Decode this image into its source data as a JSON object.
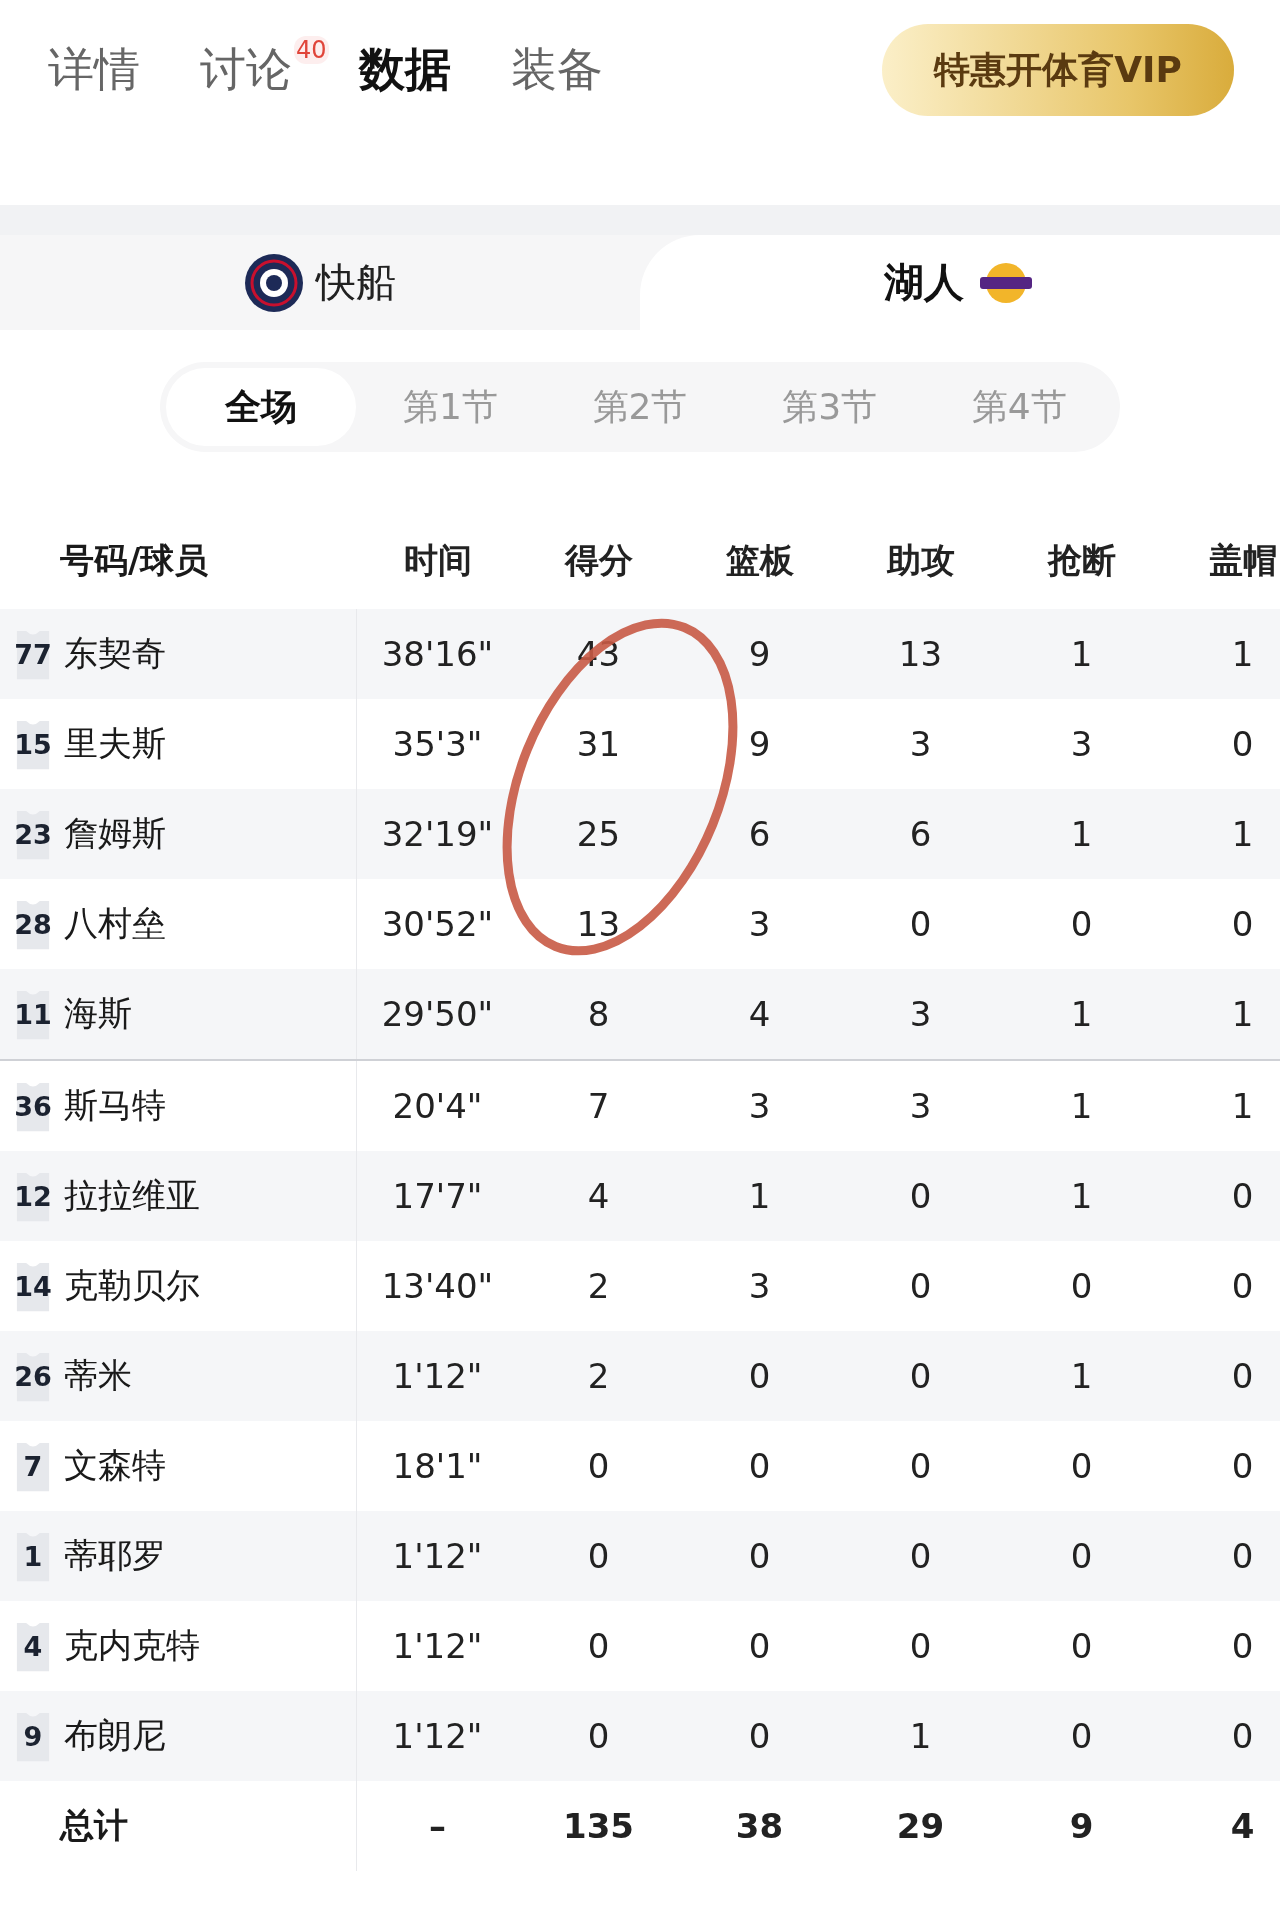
{
  "nav_tabs": [
    {
      "label": "详情",
      "selected": false
    },
    {
      "label": "讨论",
      "selected": false,
      "badge": "40"
    },
    {
      "label": "数据",
      "selected": true
    },
    {
      "label": "装备",
      "selected": false
    }
  ],
  "vip_button": "特惠开体育VIP",
  "teams": [
    {
      "name": "快船",
      "selected": false
    },
    {
      "name": "湖人",
      "selected": true
    }
  ],
  "periods": [
    {
      "label": "全场",
      "selected": true
    },
    {
      "label": "第1节",
      "selected": false
    },
    {
      "label": "第2节",
      "selected": false
    },
    {
      "label": "第3节",
      "selected": false
    },
    {
      "label": "第4节",
      "selected": false
    }
  ],
  "table": {
    "columns": [
      "号码/球员",
      "时间",
      "得分",
      "篮板",
      "助攻",
      "抢断",
      "盖帽"
    ],
    "starters": [
      {
        "number": "77",
        "name": "东契奇",
        "stats": [
          "38'16\"",
          "43",
          "9",
          "13",
          "1",
          "1"
        ]
      },
      {
        "number": "15",
        "name": "里夫斯",
        "stats": [
          "35'3\"",
          "31",
          "9",
          "3",
          "3",
          "0"
        ]
      },
      {
        "number": "23",
        "name": "詹姆斯",
        "stats": [
          "32'19\"",
          "25",
          "6",
          "6",
          "1",
          "1"
        ]
      },
      {
        "number": "28",
        "name": "八村垒",
        "stats": [
          "30'52\"",
          "13",
          "3",
          "0",
          "0",
          "0"
        ]
      },
      {
        "number": "11",
        "name": "海斯",
        "stats": [
          "29'50\"",
          "8",
          "4",
          "3",
          "1",
          "1"
        ]
      }
    ],
    "bench": [
      {
        "number": "36",
        "name": "斯马特",
        "stats": [
          "20'4\"",
          "7",
          "3",
          "3",
          "1",
          "1"
        ]
      },
      {
        "number": "12",
        "name": "拉拉维亚",
        "stats": [
          "17'7\"",
          "4",
          "1",
          "0",
          "1",
          "0"
        ]
      },
      {
        "number": "14",
        "name": "克勒贝尔",
        "stats": [
          "13'40\"",
          "2",
          "3",
          "0",
          "0",
          "0"
        ]
      },
      {
        "number": "26",
        "name": "蒂米",
        "stats": [
          "1'12\"",
          "2",
          "0",
          "0",
          "1",
          "0"
        ]
      },
      {
        "number": "7",
        "name": "文森特",
        "stats": [
          "18'1\"",
          "0",
          "0",
          "0",
          "0",
          "0"
        ]
      },
      {
        "number": "1",
        "name": "蒂耶罗",
        "stats": [
          "1'12\"",
          "0",
          "0",
          "0",
          "0",
          "0"
        ]
      },
      {
        "number": "4",
        "name": "克内克特",
        "stats": [
          "1'12\"",
          "0",
          "0",
          "0",
          "0",
          "0"
        ]
      },
      {
        "number": "9",
        "name": "布朗尼",
        "stats": [
          "1'12\"",
          "0",
          "0",
          "1",
          "0",
          "0"
        ]
      }
    ],
    "total": {
      "label": "总计",
      "stats": [
        "–",
        "135",
        "38",
        "29",
        "9",
        "4"
      ]
    }
  }
}
